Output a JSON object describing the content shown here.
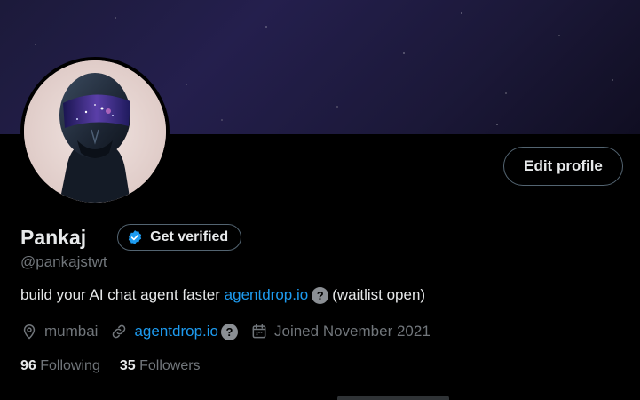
{
  "profile": {
    "name": "Pankaj",
    "handle": "@pankajstwt",
    "verify_label": "Get verified",
    "edit_label": "Edit profile"
  },
  "bio": {
    "text": "build your AI chat agent faster",
    "link": "agentdrop.io",
    "info_glyph": "?",
    "suffix": "(waitlist open)"
  },
  "meta": {
    "location": "mumbai",
    "website": "agentdrop.io",
    "website_info_glyph": "?",
    "joined": "Joined November 2021"
  },
  "stats": {
    "following_count": "96",
    "following_label": "Following",
    "followers_count": "35",
    "followers_label": "Followers"
  },
  "icons": {
    "verified": "verified-badge-icon",
    "location": "location-pin-icon",
    "link": "link-icon",
    "calendar": "calendar-icon"
  },
  "colors": {
    "background": "#000000",
    "text": "#e7e9ea",
    "muted": "#71767b",
    "link": "#1d9bf0",
    "border": "#536471"
  }
}
